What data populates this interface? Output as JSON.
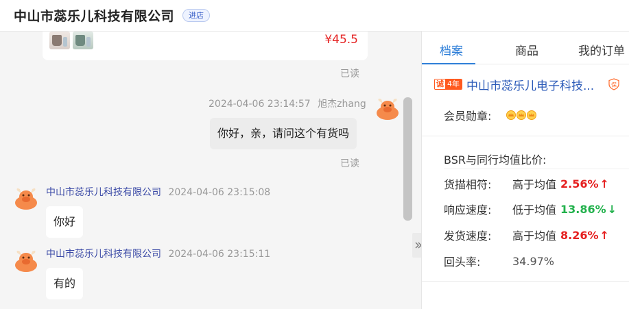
{
  "header": {
    "shop_name": "中山市蕊乐儿科技有限公司",
    "enter_store_label": "进店"
  },
  "chat": {
    "product_card": {
      "price": "¥45.5"
    },
    "messages": [
      {
        "read_status": "已读"
      },
      {
        "sender": "旭杰zhang",
        "time": "2024-04-06 23:14:57",
        "text": "你好，亲，请问这个有货吗",
        "read_status": "已读"
      },
      {
        "sender": "中山市蕊乐儿科技有限公司",
        "time": "2024-04-06 23:15:08",
        "text": "你好"
      },
      {
        "sender": "中山市蕊乐儿科技有限公司",
        "time": "2024-04-06 23:15:11",
        "text": "有的"
      }
    ]
  },
  "panel": {
    "tabs": [
      {
        "label": "档案",
        "active": true
      },
      {
        "label": "商品",
        "active": false
      },
      {
        "label": "我的订单",
        "active": false
      }
    ],
    "shop": {
      "badge_char": "诚",
      "badge_years": "4年",
      "name": "中山市蕊乐儿电子科技..."
    },
    "medal_label": "会员勋章:",
    "bsr_title": "BSR与同行均值比价:",
    "metrics": [
      {
        "label": "货描相符:",
        "comparison": "高于均值",
        "value": "2.56%",
        "arrow": "↑",
        "trend": "up"
      },
      {
        "label": "响应速度:",
        "comparison": "低于均值",
        "value": "13.86%",
        "arrow": "↓",
        "trend": "down"
      },
      {
        "label": "发货速度:",
        "comparison": "高于均值",
        "value": "8.26%",
        "arrow": "↑",
        "trend": "up"
      }
    ],
    "repeat_rate": {
      "label": "回头率:",
      "value": "34.97%"
    }
  },
  "colors": {
    "accent_blue": "#2f7fd8",
    "price_red": "#e52525",
    "up_red": "#e52020",
    "down_green": "#22b14c",
    "badge_orange": "#ff5a1f"
  },
  "icons": [
    "cow-avatar-icon",
    "shield-bao-icon",
    "crown-medal-icon",
    "double-chevron-right-icon"
  ]
}
